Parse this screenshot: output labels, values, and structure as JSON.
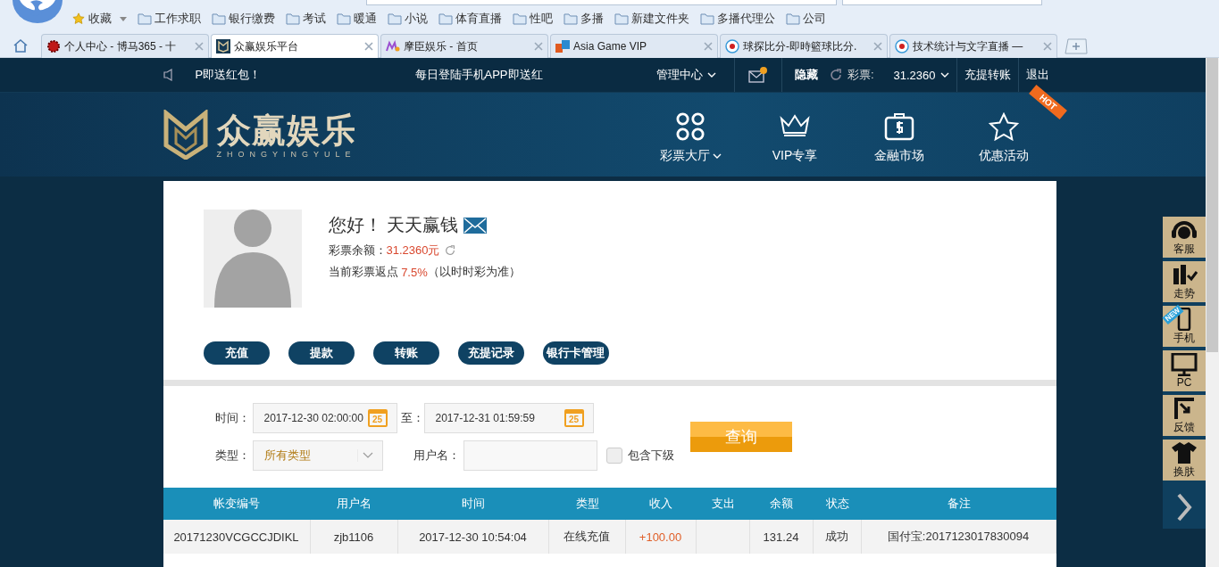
{
  "browser": {
    "bookmarks": [
      {
        "label": "收藏",
        "kind": "star"
      },
      {
        "label": "工作求职",
        "kind": "folder"
      },
      {
        "label": "银行缴费",
        "kind": "folder"
      },
      {
        "label": "考试",
        "kind": "folder"
      },
      {
        "label": "暖通",
        "kind": "folder"
      },
      {
        "label": "小说",
        "kind": "folder"
      },
      {
        "label": "体育直播",
        "kind": "folder"
      },
      {
        "label": "性吧",
        "kind": "folder"
      },
      {
        "label": "多播",
        "kind": "folder"
      },
      {
        "label": "新建文件夹",
        "kind": "folder"
      },
      {
        "label": "多播代理公",
        "kind": "folder"
      },
      {
        "label": "公司",
        "kind": "folder"
      }
    ],
    "tabs": [
      {
        "title": "个人中心 - 博马365 - 十",
        "selected": false,
        "kind": "gear"
      },
      {
        "title": "众赢娱乐平台",
        "selected": true,
        "kind": "logo"
      },
      {
        "title": "摩臣娱乐 - 首页",
        "selected": false,
        "kind": "m"
      },
      {
        "title": "Asia Game VIP",
        "selected": false,
        "kind": "ag"
      },
      {
        "title": "球探比分-即時籃球比分.",
        "selected": false,
        "kind": "ball"
      },
      {
        "title": "技术统计与文字直播 —",
        "selected": false,
        "kind": "ball"
      }
    ]
  },
  "topbar": {
    "notice": "P即送红包！",
    "promo": "每日登陆手机APP即送红",
    "menu": "管理中心",
    "mail_unread": true,
    "hide": "隐藏",
    "lottery_label": "彩票:",
    "balance": "31.2360",
    "links": [
      "充提转账",
      "退出"
    ]
  },
  "header": {
    "logo_title": "众赢娱乐",
    "logo_subtitle": "ZHONGYINGYULE",
    "nav": [
      {
        "label": "彩票大厅",
        "kind": "grid",
        "dropdown": true
      },
      {
        "label": "VIP专享",
        "kind": "crown",
        "dropdown": false
      },
      {
        "label": "金融市场",
        "kind": "case",
        "dropdown": false
      },
      {
        "label": "优惠活动",
        "kind": "star",
        "dropdown": false
      }
    ],
    "hot_badge": "HOT"
  },
  "profile": {
    "greeting": "您好！ 天天赢钱",
    "balance_label": "彩票余额：",
    "balance": "31.2360元",
    "rebate_label": "当前彩票返点",
    "rebate": "7.5%",
    "rebate_note": "（以时时彩为准）",
    "buttons": [
      "充值",
      "提款",
      "转账",
      "充提记录",
      "银行卡管理"
    ]
  },
  "filter": {
    "time_label": "时间：",
    "from": "2017-12-30 02:00:00",
    "to_label": "至：",
    "to": "2017-12-31 01:59:59",
    "from_calendar_day": "25",
    "to_calendar_day": "25",
    "type_label": "类型：",
    "type_value": "所有类型",
    "username_label": "用户名：",
    "include_sub": {
      "label": "包含下级",
      "checked": false
    },
    "query": "查询"
  },
  "table": {
    "columns": [
      "帐变编号",
      "用户名",
      "时间",
      "类型",
      "收入",
      "支出",
      "余额",
      "状态",
      "备注"
    ],
    "rows": [
      {
        "cells": [
          "20171230VCGCCJDIKL",
          "zjb1106",
          "2017-12-30 10:54:04",
          "在线充值",
          "+100.00",
          "",
          "131.24",
          "成功",
          "国付宝:2017123017830094"
        ]
      }
    ]
  },
  "side_toolbar": [
    {
      "label": "客服",
      "kind": "headset"
    },
    {
      "label": "走势",
      "kind": "chart"
    },
    {
      "label": "手机",
      "kind": "phone",
      "badge": "NEW"
    },
    {
      "label": "PC",
      "kind": "monitor"
    },
    {
      "label": "反馈",
      "kind": "feedback"
    },
    {
      "label": "换肤",
      "kind": "shirt"
    }
  ]
}
